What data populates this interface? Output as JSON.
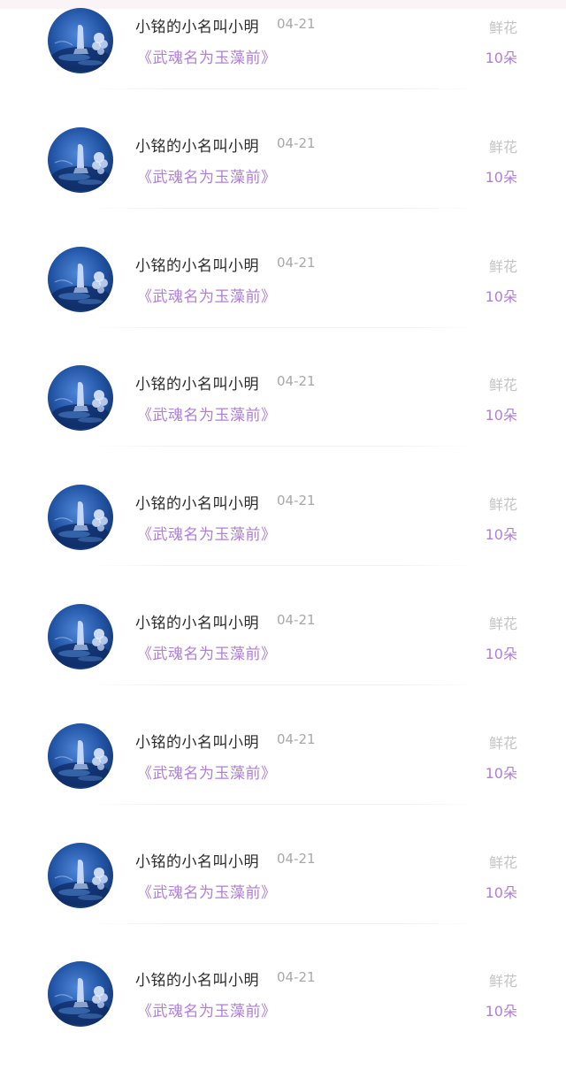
{
  "entries": [
    {
      "name": "小铭的小名叫小明",
      "date": "04-21",
      "book": "《武魂名为玉藻前》",
      "gift_label": "鲜花",
      "gift_count": "10朵"
    },
    {
      "name": "小铭的小名叫小明",
      "date": "04-21",
      "book": "《武魂名为玉藻前》",
      "gift_label": "鲜花",
      "gift_count": "10朵"
    },
    {
      "name": "小铭的小名叫小明",
      "date": "04-21",
      "book": "《武魂名为玉藻前》",
      "gift_label": "鲜花",
      "gift_count": "10朵"
    },
    {
      "name": "小铭的小名叫小明",
      "date": "04-21",
      "book": "《武魂名为玉藻前》",
      "gift_label": "鲜花",
      "gift_count": "10朵"
    },
    {
      "name": "小铭的小名叫小明",
      "date": "04-21",
      "book": "《武魂名为玉藻前》",
      "gift_label": "鲜花",
      "gift_count": "10朵"
    },
    {
      "name": "小铭的小名叫小明",
      "date": "04-21",
      "book": "《武魂名为玉藻前》",
      "gift_label": "鲜花",
      "gift_count": "10朵"
    },
    {
      "name": "小铭的小名叫小明",
      "date": "04-21",
      "book": "《武魂名为玉藻前》",
      "gift_label": "鲜花",
      "gift_count": "10朵"
    },
    {
      "name": "小铭的小名叫小明",
      "date": "04-21",
      "book": "《武魂名为玉藻前》",
      "gift_label": "鲜花",
      "gift_count": "10朵"
    },
    {
      "name": "小铭的小名叫小明",
      "date": "04-21",
      "book": "《武魂名为玉藻前》",
      "gift_label": "鲜花",
      "gift_count": "10朵"
    }
  ],
  "colors": {
    "name_text": "#2b2b2b",
    "date_text": "#a8a8a8",
    "book_accent": "#b07fd6",
    "gift_label_text": "#c4c4c4",
    "gift_count_accent": "#b07fd6",
    "avatar_theme": "#2457a8"
  },
  "icons": {
    "avatar": "user-avatar-moonlit-water"
  }
}
